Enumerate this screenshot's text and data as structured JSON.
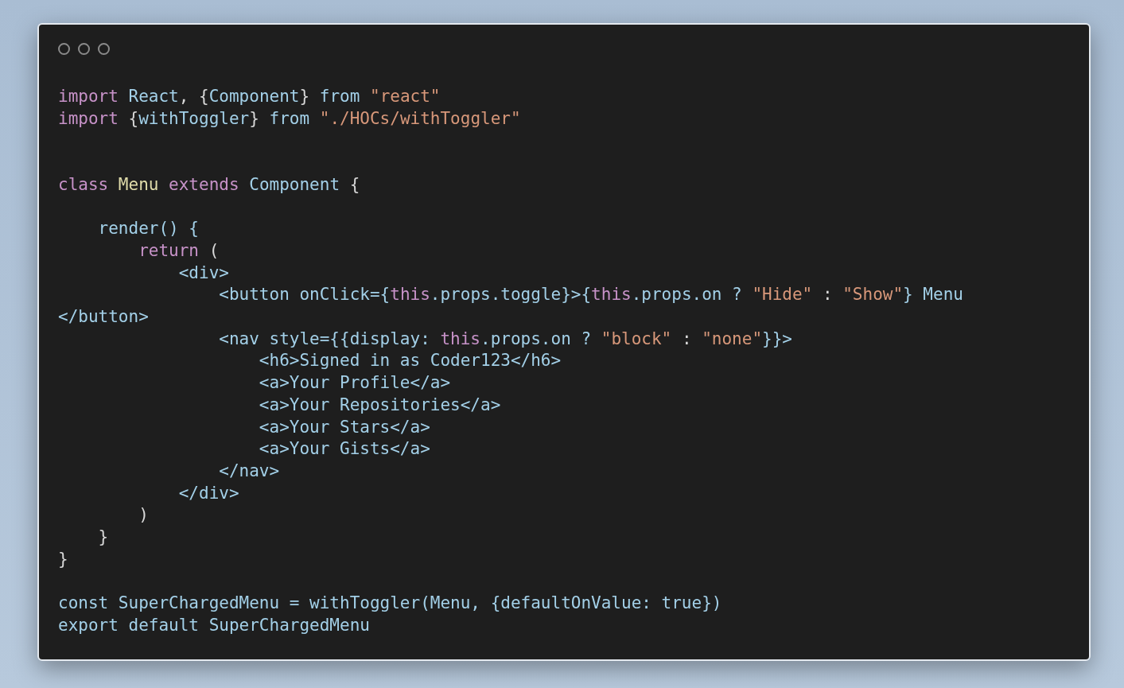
{
  "window": {
    "controls": [
      {
        "kind": "circle"
      },
      {
        "kind": "circle"
      },
      {
        "kind": "circle"
      }
    ]
  },
  "code": [
    {
      "kind": "code",
      "tokens": [
        {
          "kind": "keyword",
          "text": "import "
        },
        {
          "kind": "ident",
          "text": "React"
        },
        {
          "kind": "plain",
          "text": ", {"
        },
        {
          "kind": "ident",
          "text": "Component"
        },
        {
          "kind": "plain",
          "text": "} "
        },
        {
          "kind": "ident",
          "text": "from "
        },
        {
          "kind": "string",
          "text": "\"react\""
        }
      ]
    },
    {
      "kind": "code",
      "tokens": [
        {
          "kind": "keyword",
          "text": "import"
        },
        {
          "kind": "plain",
          "text": " {"
        },
        {
          "kind": "ident",
          "text": "withToggler"
        },
        {
          "kind": "plain",
          "text": "} "
        },
        {
          "kind": "ident",
          "text": "from "
        },
        {
          "kind": "string",
          "text": "\"./HOCs/withToggler\""
        }
      ]
    },
    {
      "kind": "blank"
    },
    {
      "kind": "blank"
    },
    {
      "kind": "code",
      "tokens": [
        {
          "kind": "keyword",
          "text": "class "
        },
        {
          "kind": "classname",
          "text": "Menu "
        },
        {
          "kind": "keyword",
          "text": "extends "
        },
        {
          "kind": "ident",
          "text": "Component"
        },
        {
          "kind": "plain",
          "text": " {"
        }
      ]
    },
    {
      "kind": "blank"
    },
    {
      "kind": "code",
      "tokens": [
        {
          "kind": "ident",
          "text": "    render() {"
        }
      ]
    },
    {
      "kind": "code",
      "tokens": [
        {
          "kind": "keyword",
          "text": "        return"
        },
        {
          "kind": "plain",
          "text": " ("
        }
      ]
    },
    {
      "kind": "code",
      "tokens": [
        {
          "kind": "ident",
          "text": "            <div>"
        }
      ]
    },
    {
      "kind": "code",
      "tokens": [
        {
          "kind": "ident",
          "text": "                <button onClick={"
        },
        {
          "kind": "this",
          "text": "this"
        },
        {
          "kind": "ident",
          "text": ".props.toggle}>{"
        },
        {
          "kind": "this",
          "text": "this"
        },
        {
          "kind": "ident",
          "text": ".props.on ? "
        },
        {
          "kind": "string",
          "text": "\"Hide\""
        },
        {
          "kind": "plain",
          "text": " : "
        },
        {
          "kind": "string",
          "text": "\"Show\""
        },
        {
          "kind": "ident",
          "text": "} Menu"
        }
      ]
    },
    {
      "kind": "code",
      "tokens": [
        {
          "kind": "ident",
          "text": "</button>"
        }
      ]
    },
    {
      "kind": "code",
      "tokens": [
        {
          "kind": "ident",
          "text": "                <nav style={{display: "
        },
        {
          "kind": "this",
          "text": "this"
        },
        {
          "kind": "ident",
          "text": ".props.on ? "
        },
        {
          "kind": "string",
          "text": "\"block\""
        },
        {
          "kind": "plain",
          "text": " : "
        },
        {
          "kind": "string",
          "text": "\"none\""
        },
        {
          "kind": "ident",
          "text": "}}>"
        }
      ]
    },
    {
      "kind": "code",
      "tokens": [
        {
          "kind": "ident",
          "text": "                    <h6>Signed in as Coder123</h6>"
        }
      ]
    },
    {
      "kind": "code",
      "tokens": [
        {
          "kind": "ident",
          "text": "                    <a>Your Profile</a>"
        }
      ]
    },
    {
      "kind": "code",
      "tokens": [
        {
          "kind": "ident",
          "text": "                    <a>Your Repositories</a>"
        }
      ]
    },
    {
      "kind": "code",
      "tokens": [
        {
          "kind": "ident",
          "text": "                    <a>Your Stars</a>"
        }
      ]
    },
    {
      "kind": "code",
      "tokens": [
        {
          "kind": "ident",
          "text": "                    <a>Your Gists</a>"
        }
      ]
    },
    {
      "kind": "code",
      "tokens": [
        {
          "kind": "ident",
          "text": "                </nav>"
        }
      ]
    },
    {
      "kind": "code",
      "tokens": [
        {
          "kind": "ident",
          "text": "            </div>"
        }
      ]
    },
    {
      "kind": "code",
      "tokens": [
        {
          "kind": "plain",
          "text": "        )"
        }
      ]
    },
    {
      "kind": "code",
      "tokens": [
        {
          "kind": "plain",
          "text": "    }"
        }
      ]
    },
    {
      "kind": "code",
      "tokens": [
        {
          "kind": "plain",
          "text": "}"
        }
      ]
    },
    {
      "kind": "blank"
    },
    {
      "kind": "code",
      "tokens": [
        {
          "kind": "ident",
          "text": "const SuperChargedMenu = withToggler(Menu, {defaultOnValue: true})"
        }
      ]
    },
    {
      "kind": "code",
      "tokens": [
        {
          "kind": "ident",
          "text": "export default SuperChargedMenu"
        }
      ]
    }
  ]
}
